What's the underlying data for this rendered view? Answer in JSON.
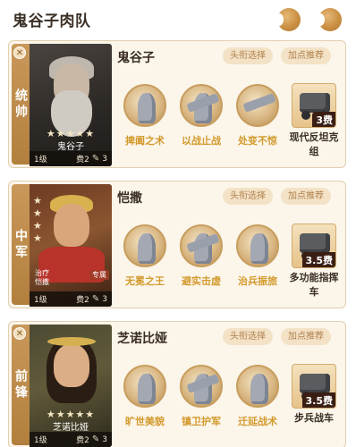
{
  "page": {
    "title": "鬼谷子肉队"
  },
  "header_icons": [
    "back-arrow-icon",
    "forward-arrow-icon"
  ],
  "colors": {
    "position_strip": "#b27f3d",
    "skill_label": "#d39a2c",
    "chip_bg": "#f3e2c6",
    "chip_text": "#b0804c",
    "card_bg": "#fbf5ea",
    "cost_badge_bg": "#3a1e14"
  },
  "lineup": [
    {
      "position": "统帅",
      "general": {
        "name": "鬼谷子",
        "portrait_name": "鬼谷子",
        "stars": "★★★★★",
        "level": "1级",
        "cost": "费2",
        "count": "3"
      },
      "title_button": "头衔选择",
      "points_button": "加点推荐",
      "skills": [
        "捭阖之术",
        "以战止战",
        "处变不惊"
      ],
      "gear": {
        "name": "现代反坦克组",
        "cost": "3费"
      }
    },
    {
      "position": "中军",
      "general": {
        "name": "恺撒",
        "portrait_name": "恺撒",
        "portrait_subtitle": "治疗",
        "tag": "专属",
        "stars": "★\n★\n★\n★",
        "level": "1级",
        "cost": "费2",
        "count": "3"
      },
      "title_button": "头衔选择",
      "points_button": "加点推荐",
      "skills": [
        "无冕之王",
        "避实击虚",
        "治兵振旅"
      ],
      "gear": {
        "name": "多功能指挥车",
        "cost": "3.5费"
      }
    },
    {
      "position": "前锋",
      "general": {
        "name": "芝诺比娅",
        "portrait_name": "芝诺比娅",
        "stars": "★★★★★",
        "level": "1级",
        "cost": "费2",
        "count": "3"
      },
      "title_button": "头衔选择",
      "points_button": "加点推荐",
      "skills": [
        "旷世美貌",
        "镇卫护军",
        "迁延战术"
      ],
      "gear": {
        "name": "步兵战车",
        "cost": "3.5费"
      }
    }
  ]
}
